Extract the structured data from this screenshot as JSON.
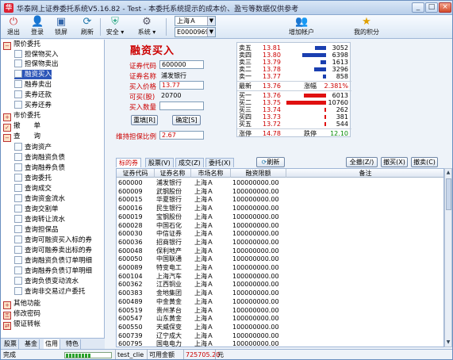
{
  "window": {
    "title": "华泰网上证券委托系统V5.16.82 - Test - 本委托系统提示的成本价、盈亏等数据仅供参考",
    "controls": [
      "_",
      "□",
      "×"
    ]
  },
  "toolbar": {
    "buttons": [
      {
        "label": "退出",
        "icon": "exit-icon"
      },
      {
        "label": "登录",
        "icon": "login-icon"
      },
      {
        "label": "锁屏",
        "icon": "lock-icon"
      },
      {
        "label": "刷新",
        "icon": "refresh-icon"
      },
      {
        "label": "安全",
        "icon": "shield-icon"
      },
      {
        "label": "系统",
        "icon": "gear-icon"
      }
    ],
    "market": "上海Ａ",
    "account": "E000096912",
    "add_account": "增加帐户",
    "my_points": "我的积分"
  },
  "tree": {
    "items": [
      {
        "label": "限价委托",
        "level": 0
      },
      {
        "label": "担保物买入",
        "level": 1
      },
      {
        "label": "担保物卖出",
        "level": 1
      },
      {
        "label": "融资买入",
        "level": 1,
        "selected": true
      },
      {
        "label": "融券卖出",
        "level": 1
      },
      {
        "label": "卖券还款",
        "level": 1
      },
      {
        "label": "买券还券",
        "level": 1
      },
      {
        "label": "市价委托",
        "level": 0
      },
      {
        "label": "撤　　单",
        "level": 0
      },
      {
        "label": "查　　询",
        "level": 0
      },
      {
        "label": "查询资产",
        "level": 1
      },
      {
        "label": "查询融资负债",
        "level": 1
      },
      {
        "label": "查询融券负债",
        "level": 1
      },
      {
        "label": "查询委托",
        "level": 1
      },
      {
        "label": "查询成交",
        "level": 1
      },
      {
        "label": "查询资金流水",
        "level": 1
      },
      {
        "label": "查询交割单",
        "level": 1
      },
      {
        "label": "查询转让流水",
        "level": 1
      },
      {
        "label": "查询担保品",
        "level": 1
      },
      {
        "label": "查询可融资买入标的券",
        "level": 1
      },
      {
        "label": "查询可融券卖出标的券",
        "level": 1
      },
      {
        "label": "查询融资负债订单明细",
        "level": 1
      },
      {
        "label": "查询融券负债订单明细",
        "level": 1
      },
      {
        "label": "查询负债变动流水",
        "level": 1
      },
      {
        "label": "查询非交易过户委托",
        "level": 1
      },
      {
        "label": "其他功能",
        "level": 0
      },
      {
        "label": "修改密码",
        "level": 0
      },
      {
        "label": "银证转帐",
        "level": 0
      }
    ],
    "bottom_tabs": [
      "股票",
      "基金",
      "信用",
      "特色"
    ],
    "active_tab": "信用"
  },
  "form": {
    "title": "融资买入",
    "code_label": "证券代码",
    "code_value": "600000",
    "name_label": "证券名称",
    "name_value": "浦发银行",
    "price_label": "买入价格",
    "price_value": "13.77",
    "available_label": "可买(股)",
    "available_value": "20700",
    "qty_label": "买入数量",
    "qty_value": "",
    "reset_button": "重填[R]",
    "ok_button": "确定[S]",
    "ratio_label": "维持担保比例",
    "ratio_value": "2.67"
  },
  "quote": {
    "sell": [
      {
        "label": "卖五",
        "price": "13.81",
        "volume": "3052",
        "bar": 0.28
      },
      {
        "label": "卖四",
        "price": "13.80",
        "volume": "6398",
        "bar": 0.6
      },
      {
        "label": "卖三",
        "price": "13.79",
        "volume": "1613",
        "bar": 0.15
      },
      {
        "label": "卖二",
        "price": "13.78",
        "volume": "3296",
        "bar": 0.31
      },
      {
        "label": "卖一",
        "price": "13.77",
        "volume": "858",
        "bar": 0.08
      }
    ],
    "latest_label": "最新",
    "latest": "13.76",
    "change_label": "涨幅",
    "change": "2.381%",
    "buy": [
      {
        "label": "买一",
        "price": "13.76",
        "volume": "6013",
        "bar": 0.56
      },
      {
        "label": "买二",
        "price": "13.75",
        "volume": "10760",
        "bar": 1.0
      },
      {
        "label": "买三",
        "price": "13.74",
        "volume": "262",
        "bar": 0.03
      },
      {
        "label": "买四",
        "price": "13.73",
        "volume": "381",
        "bar": 0.04
      },
      {
        "label": "买五",
        "price": "13.72",
        "volume": "544",
        "bar": 0.05
      }
    ],
    "limit_up_label": "涨停",
    "limit_up": "14.78",
    "limit_down_label": "跌停",
    "limit_down": "12.10"
  },
  "grid": {
    "tabs": [
      "标的券",
      "股票(V)",
      "成交(Z)",
      "委托(X)"
    ],
    "active_tab": "标的券",
    "refresh": "刷新",
    "buttons": [
      "全撤(Z/)",
      "撤买(X)",
      "撤卖(C)"
    ],
    "columns": [
      "证券代码",
      "证券名称",
      "市场名称",
      "融资限额",
      "备注"
    ],
    "rows": [
      [
        "600000",
        "浦发银行",
        "上海Ａ",
        "100000000.00",
        ""
      ],
      [
        "600009",
        "武钢股份",
        "上海Ａ",
        "100000000.00",
        ""
      ],
      [
        "600015",
        "华夏银行",
        "上海Ａ",
        "100000000.00",
        ""
      ],
      [
        "600016",
        "民生银行",
        "上海Ａ",
        "100000000.00",
        ""
      ],
      [
        "600019",
        "宝钢股份",
        "上海Ａ",
        "100000000.00",
        ""
      ],
      [
        "600028",
        "中国石化",
        "上海Ａ",
        "100000000.00",
        ""
      ],
      [
        "600030",
        "中信证券",
        "上海Ａ",
        "100000000.00",
        ""
      ],
      [
        "600036",
        "招商银行",
        "上海Ａ",
        "100000000.00",
        ""
      ],
      [
        "600048",
        "保利地产",
        "上海Ａ",
        "100000000.00",
        ""
      ],
      [
        "600050",
        "中国联通",
        "上海Ａ",
        "100000000.00",
        ""
      ],
      [
        "600089",
        "特变电工",
        "上海Ａ",
        "100000000.00",
        ""
      ],
      [
        "600104",
        "上海汽车",
        "上海Ａ",
        "100000000.00",
        ""
      ],
      [
        "600362",
        "江西铜业",
        "上海Ａ",
        "100000000.00",
        ""
      ],
      [
        "600383",
        "金地集团",
        "上海Ａ",
        "100000000.00",
        ""
      ],
      [
        "600489",
        "中金黄金",
        "上海Ａ",
        "100000000.00",
        ""
      ],
      [
        "600519",
        "贵州茅台",
        "上海Ａ",
        "100000000.00",
        ""
      ],
      [
        "600547",
        "山东黄金",
        "上海Ａ",
        "100000000.00",
        ""
      ],
      [
        "600550",
        "天威保变",
        "上海Ａ",
        "100000000.00",
        ""
      ],
      [
        "600739",
        "辽宁成大",
        "上海Ａ",
        "100000000.00",
        ""
      ],
      [
        "600795",
        "国电电力",
        "上海Ａ",
        "100000000.00",
        ""
      ]
    ]
  },
  "status": {
    "text": "完成",
    "progress": 0.55,
    "user": "test_clie",
    "fund_label": "可用金额",
    "fund_value": "725705.20",
    "unit": "元"
  },
  "colors": {
    "accent_red": "#cc0000",
    "selected": "#2c55b8",
    "sell_bar": "#1a3fb0",
    "buy_bar": "#e01010"
  }
}
